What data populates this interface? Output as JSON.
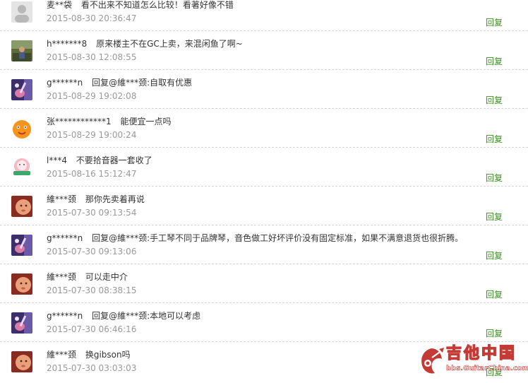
{
  "comments": [
    {
      "user": "麦**袋",
      "content": "看不出来不知道怎么比较！看著好像不错",
      "time": "2015-08-30 20:36:47",
      "reply": "回复",
      "avatar": "default-gray"
    },
    {
      "user": "h*******8",
      "content": "原来楼主不在GC上卖，来混闲鱼了啊~",
      "time": "2015-08-30 12:08:55",
      "reply": "回复",
      "avatar": "photo-outdoor"
    },
    {
      "user": "g******n",
      "content": "回复@維***颈:自取有优惠",
      "time": "2015-08-29 19:02:08",
      "reply": "回复",
      "avatar": "guitar-purple"
    },
    {
      "user": "张************1",
      "content": "能便宜一点吗",
      "time": "2015-08-29 19:00:24",
      "reply": "回复",
      "avatar": "orange-cartoon"
    },
    {
      "user": "l***4",
      "content": "不要拾音器一套收了",
      "time": "2015-08-16 15:12:47",
      "reply": "回复",
      "avatar": "pink-badge"
    },
    {
      "user": "維***颈",
      "content": "那你先卖着再说",
      "time": "2015-07-30 09:13:54",
      "reply": "回复",
      "avatar": "baby-photo"
    },
    {
      "user": "g******n",
      "content": "回复@維***颈:手工琴不同于品牌琴，音色做工好坏评价没有固定标准，如果不满意退货也很折腾。",
      "time": "2015-07-30 09:13:06",
      "reply": "回复",
      "avatar": "guitar-purple"
    },
    {
      "user": "維***颈",
      "content": "可以走中介",
      "time": "2015-07-30 08:38:15",
      "reply": "回复",
      "avatar": "baby-photo"
    },
    {
      "user": "g******n",
      "content": "回复@維***颈:本地可以考虑",
      "time": "2015-07-30 06:46:16",
      "reply": "回复",
      "avatar": "guitar-purple"
    },
    {
      "user": "維***颈",
      "content": "换gibson吗",
      "time": "2015-07-30 03:03:03",
      "reply": "回复",
      "avatar": "baby-photo"
    }
  ],
  "watermark": {
    "logo_text": "吉他中国",
    "url": "bbs.GuitarChina.com"
  },
  "colors": {
    "reply_link": "#3a8f1f",
    "timestamp": "#999999",
    "divider": "#d6d6d6",
    "watermark": "#c43a35"
  }
}
